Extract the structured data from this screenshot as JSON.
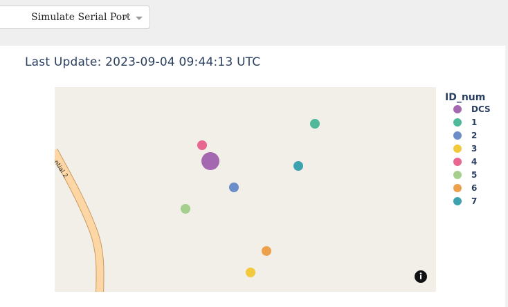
{
  "toolbar": {
    "port_select": {
      "value": "Simulate Serial Port",
      "clear_symbol": "×",
      "caret_icon": "chevron-down-icon"
    }
  },
  "status": {
    "last_update": "Last Update: 2023-09-04 09:44:13 UTC"
  },
  "map": {
    "background_color": "#f2efe9",
    "road_label": "ntial 2",
    "road_color": "#fcd6a4",
    "info_icon": "info-icon",
    "legend": {
      "title": "ID_num",
      "items": [
        {
          "label": "DCS",
          "color": "#a468b1"
        },
        {
          "label": "1",
          "color": "#4fb99a"
        },
        {
          "label": "2",
          "color": "#6c8ec8"
        },
        {
          "label": "3",
          "color": "#f2c93b"
        },
        {
          "label": "4",
          "color": "#e8668f"
        },
        {
          "label": "5",
          "color": "#a4cf8c"
        },
        {
          "label": "6",
          "color": "#eda14c"
        },
        {
          "label": "7",
          "color": "#3ea2ae"
        }
      ]
    }
  }
}
